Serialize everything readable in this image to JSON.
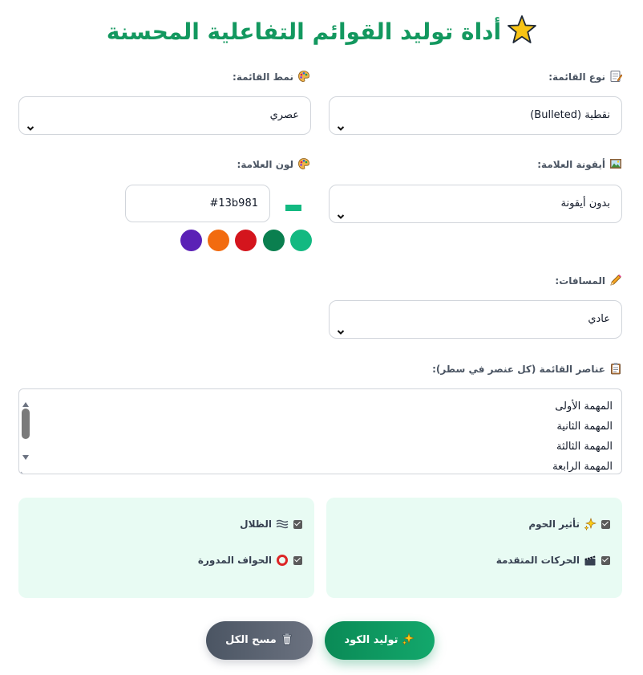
{
  "title": "أداة توليد القوائم التفاعلية المحسنة",
  "list_type": {
    "label": "نوع القائمة:",
    "value": "نقطية (Bulleted)"
  },
  "list_style": {
    "label": "نمط القائمة:",
    "value": "عصري"
  },
  "marker_icon": {
    "label": "أيقونة العلامة:",
    "value": "بدون أيقونة"
  },
  "marker_color": {
    "label": "لون العلامة:",
    "value": "#13b981",
    "presets": [
      "#13b981",
      "#0a7f4f",
      "#d4151d",
      "#f26b0f",
      "#5b21b6"
    ]
  },
  "spacing": {
    "label": "المسافات:",
    "value": "عادي"
  },
  "items": {
    "label": "عناصر القائمة (كل عنصر في سطر):",
    "lines": [
      "المهمة الأولى",
      "المهمة الثانية",
      "المهمة الثالثة",
      "المهمة الرابعة"
    ]
  },
  "options": {
    "hover_effect": {
      "label": "تأثير الحوم",
      "checked": true
    },
    "advanced_animations": {
      "label": "الحركات المتقدمة",
      "checked": true
    },
    "shadows": {
      "label": "الظلال",
      "checked": true
    },
    "rounded_corners": {
      "label": "الحواف المدورة",
      "checked": true
    }
  },
  "buttons": {
    "generate": "توليد الكود",
    "clear": "مسح الكل"
  },
  "colors": {
    "accent": "#13985f",
    "panel_bg": "#e8fbf3"
  }
}
